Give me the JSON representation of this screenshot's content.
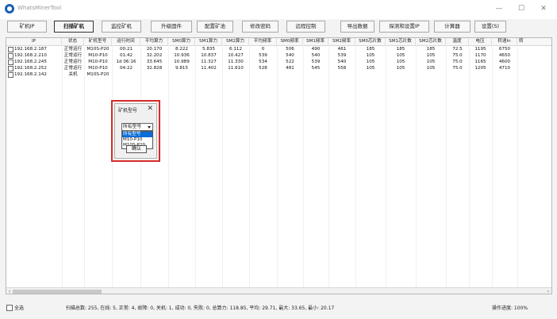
{
  "window": {
    "title": "WhatsMinerTool",
    "controls": [
      "—",
      "☐",
      "✕"
    ]
  },
  "toolbar": [
    {
      "label": "矿机IP",
      "active": false
    },
    {
      "label": "扫描矿机",
      "active": true
    },
    {
      "label": "监控矿机",
      "active": false
    },
    {
      "label": "升级固件",
      "active": false
    },
    {
      "label": "配置矿池",
      "active": false
    },
    {
      "label": "修改密码",
      "active": false
    },
    {
      "label": "远程控制",
      "active": false
    },
    {
      "label": "导出数据",
      "active": false
    },
    {
      "label": "探测和设置IP",
      "active": false
    },
    {
      "label": "计算器",
      "active": false
    },
    {
      "label": "设置(S)",
      "active": false
    }
  ],
  "table": {
    "columns": [
      "IP",
      "状态",
      "矿机型号",
      "运行时间",
      "平均算力",
      "SM0算力",
      "SM1算力",
      "SM2算力",
      "平均频率",
      "SM0频率",
      "SM1频率",
      "SM2频率",
      "SM0芯片数",
      "SM1芯片数",
      "SM2芯片数",
      "温度",
      "电压",
      "转速In",
      "转"
    ],
    "rows": [
      [
        "192.168.2.187",
        "正常运行",
        "M10S-P20",
        "00:21",
        "20.170",
        "8.222",
        "5.835",
        "6.112",
        "0",
        "506",
        "490",
        "461",
        "185",
        "185",
        "185",
        "72.5",
        "1195",
        "6750",
        ""
      ],
      [
        "192.168.2.210",
        "正常运行",
        "M10-P10",
        "01:42",
        "32.202",
        "10.936",
        "10.837",
        "10.427",
        "539",
        "540",
        "540",
        "539",
        "105",
        "105",
        "105",
        "75.0",
        "1170",
        "4650",
        ""
      ],
      [
        "192.168.2.245",
        "正常运行",
        "M10-P10",
        "1d 06:16",
        "33.645",
        "10.989",
        "11.327",
        "11.330",
        "534",
        "522",
        "539",
        "540",
        "105",
        "105",
        "105",
        "75.0",
        "1165",
        "4600",
        ""
      ],
      [
        "192.168.2.252",
        "正常运行",
        "M10-P10",
        "04:22",
        "32.828",
        "9.815",
        "11.402",
        "11.610",
        "528",
        "481",
        "545",
        "558",
        "105",
        "105",
        "105",
        "75.0",
        "1205",
        "4710",
        ""
      ],
      [
        "192.168.2.142",
        "关机",
        "M10S-P20",
        "",
        "",
        "",
        "",
        "",
        "",
        "",
        "",
        "",
        "",
        "",
        "",
        "",
        "",
        "",
        ""
      ]
    ]
  },
  "dialog": {
    "title": "矿机型号",
    "close": "✕",
    "select_value": "所有型号",
    "options": [
      "所有型号",
      "M10-P10",
      "M10S-P20"
    ],
    "selected_option": 0,
    "ok_label": "确认"
  },
  "status": {
    "select_all": "全选",
    "summary": "扫描总数: 255, 在线: 5, 正常: 4, 故障: 0, 关机: 1, 成功: 0, 失败: 0, 总算力: 118.85, 平均: 29.71, 最大: 33.65, 最小: 20.17",
    "progress": "操作进度: 100%"
  },
  "colors": {
    "highlight_border": "#d62b2b",
    "selection": "#0b6dd8"
  }
}
